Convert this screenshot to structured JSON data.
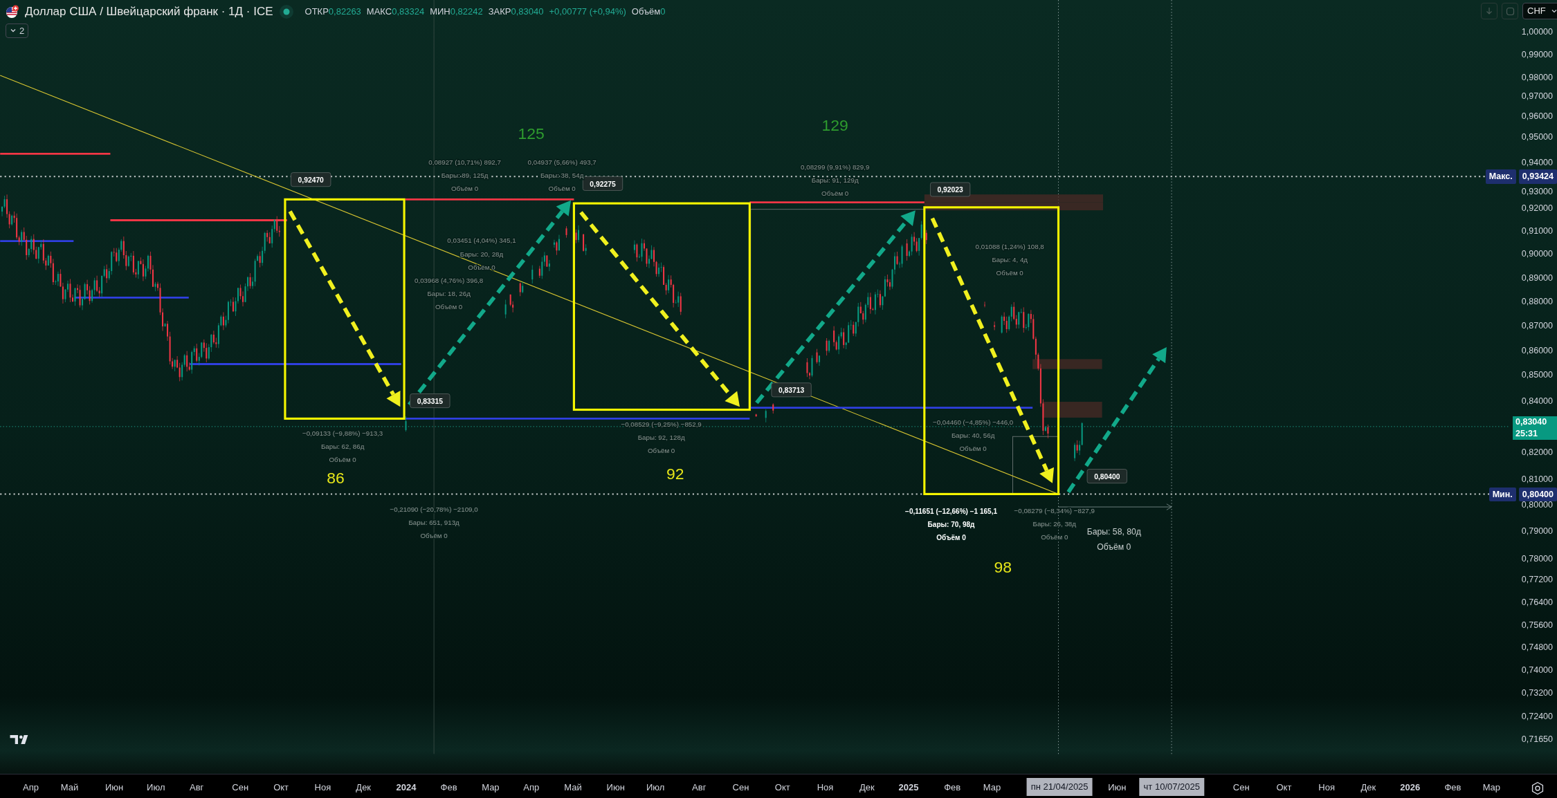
{
  "header": {
    "title": "Доллар США / Швейцарский франк · 1Д · ICE",
    "ohlc": [
      {
        "label": "ОТКР",
        "value": "0,82263"
      },
      {
        "label": "МАКС",
        "value": "0,83324"
      },
      {
        "label": "МИН",
        "value": "0,82242"
      },
      {
        "label": "ЗАКР",
        "value": "0,83040"
      }
    ],
    "change": "+0,00777 (+0,94%)",
    "volume": {
      "label": "Объём",
      "value": "0"
    },
    "indicators_toggle": "2"
  },
  "toolbar": {
    "currency": "CHF"
  },
  "chart": {
    "counts": [
      {
        "text": "125",
        "color": "#2e9c2e"
      },
      {
        "text": "129",
        "color": "#2e9c2e"
      },
      {
        "text": "86",
        "color": "#e6e619"
      },
      {
        "text": "92",
        "color": "#e6e619"
      },
      {
        "text": "98",
        "color": "#e6e619"
      }
    ],
    "price_tags": [
      "0,92470",
      "0,92275",
      "0,92023",
      "0,83315",
      "0,83713",
      "0,80400"
    ],
    "measurements": [
      {
        "kind": "faint",
        "lines": [
          "0,08927 (10,71%) 892,7",
          "Бары: 89, 125д",
          "Объём 0"
        ]
      },
      {
        "kind": "faint",
        "lines": [
          "0,04937 (5,66%) 493,7",
          "Бары: 38, 54д",
          "Объём 0"
        ]
      },
      {
        "kind": "faint",
        "lines": [
          "0,08299 (9,91%) 829,9",
          "Бары: 91, 129д",
          "Объём 0"
        ]
      },
      {
        "kind": "faint",
        "lines": [
          "0,03451 (4,04%) 345,1",
          "Бары: 20, 28д",
          "Объём 0"
        ]
      },
      {
        "kind": "faint",
        "lines": [
          "0,03968 (4,76%) 396,8",
          "Бары: 18, 26д",
          "Объём 0"
        ]
      },
      {
        "kind": "faint",
        "lines": [
          "0,01088 (1,24%) 108,8",
          "Бары: 4, 4д",
          "Объём 0"
        ]
      },
      {
        "kind": "faint",
        "lines": [
          "−0,04460 (−4,85%) −446,0",
          "Бары: 40, 56д",
          "Объём 0"
        ]
      },
      {
        "kind": "faint",
        "lines": [
          "−0,09133 (−9,88%) −913,3",
          "Бары: 62, 86д",
          "Объём 0"
        ]
      },
      {
        "kind": "faint",
        "lines": [
          "−0,08529 (−9,25%) −852,9",
          "Бары: 92, 128д",
          "Объём 0"
        ]
      },
      {
        "kind": "faint",
        "lines": [
          "−0,21090 (−20,78%) −2109,0",
          "Бары: 651, 913д",
          "Объём 0"
        ]
      },
      {
        "kind": "bold",
        "lines": [
          "−0,11651 (−12,66%) −1 165,1",
          "Бары: 70, 98д",
          "Объём 0"
        ]
      },
      {
        "kind": "faint",
        "lines": [
          "−0,08279 (−8,34%) −827,9",
          "Бары: 26, 38д",
          "Объём 0"
        ]
      },
      {
        "kind": "bright",
        "lines": [
          "Бары: 58, 80д",
          "Объём 0"
        ]
      }
    ]
  },
  "price_axis": {
    "ticks": [
      "1,00000",
      "0,99000",
      "0,98000",
      "0,97000",
      "0,96000",
      "0,95000",
      "0,94000",
      "0,93000",
      "0,92000",
      "0,91000",
      "0,90000",
      "0,89000",
      "0,88000",
      "0,87000",
      "0,86000",
      "0,85000",
      "0,84000",
      "0,82000",
      "0,81000",
      "0,80000",
      "0,79000",
      "0,78000",
      "0,77200",
      "0,76400",
      "0,75600",
      "0,74800",
      "0,74000",
      "0,73200",
      "0,72400",
      "0,71650"
    ],
    "markers": [
      {
        "tag": "Макс.",
        "value": "0,93424"
      },
      {
        "tag": "Мин.",
        "value": "0,80400"
      }
    ],
    "last_price": "0,83040",
    "countdown": "25:31"
  },
  "time_axis": {
    "labels": [
      {
        "text": "Апр",
        "kind": "month"
      },
      {
        "text": "Май",
        "kind": "month"
      },
      {
        "text": "Июн",
        "kind": "month"
      },
      {
        "text": "Июл",
        "kind": "month"
      },
      {
        "text": "Авг",
        "kind": "month"
      },
      {
        "text": "Сен",
        "kind": "month"
      },
      {
        "text": "Окт",
        "kind": "month"
      },
      {
        "text": "Ноя",
        "kind": "month"
      },
      {
        "text": "Дек",
        "kind": "month"
      },
      {
        "text": "2024",
        "kind": "year"
      },
      {
        "text": "Фев",
        "kind": "month"
      },
      {
        "text": "Мар",
        "kind": "month"
      },
      {
        "text": "Апр",
        "kind": "month"
      },
      {
        "text": "Май",
        "kind": "month"
      },
      {
        "text": "Июн",
        "kind": "month"
      },
      {
        "text": "Июл",
        "kind": "month"
      },
      {
        "text": "Авг",
        "kind": "month"
      },
      {
        "text": "Сен",
        "kind": "month"
      },
      {
        "text": "Окт",
        "kind": "month"
      },
      {
        "text": "Ноя",
        "kind": "month"
      },
      {
        "text": "Дек",
        "kind": "month"
      },
      {
        "text": "2025",
        "kind": "year"
      },
      {
        "text": "Фев",
        "kind": "month"
      },
      {
        "text": "Мар",
        "kind": "month"
      },
      {
        "text": "Июн",
        "kind": "month"
      },
      {
        "text": "Сен",
        "kind": "month"
      },
      {
        "text": "Окт",
        "kind": "month"
      },
      {
        "text": "Ноя",
        "kind": "month"
      },
      {
        "text": "Дек",
        "kind": "month"
      },
      {
        "text": "2026",
        "kind": "year"
      },
      {
        "text": "Фев",
        "kind": "month"
      },
      {
        "text": "Мар",
        "kind": "month"
      }
    ],
    "cursor_labels": [
      "пн 21/04/2025",
      "чт 10/07/2025"
    ]
  }
}
